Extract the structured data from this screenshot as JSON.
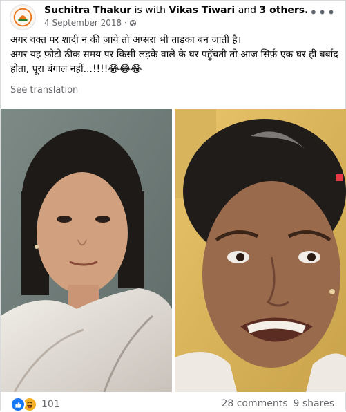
{
  "post": {
    "author": "Suchitra Thakur",
    "with_word": "is with",
    "tagged": "Vikas Tiwari",
    "and_word": "and",
    "others": "3 others.",
    "date": "4 September 2018",
    "privacy_icon": "globe-icon",
    "more_icon": "more-options-icon",
    "text_line1": "अगर वक्त पर शादी न की जाये तो अप्सरा भी ताड़का बन जाती है।",
    "text_line2": "अगर यह फ़ोटो ठीक समय पर किसी लड़के वाले के घर पहुँचती तो आज सिर्फ़ एक घर ही बर्बाद होता, पूरा बंगाल नहीं...!!!!😂😂😂",
    "see_translation": "See translation"
  },
  "footer": {
    "reaction_icons": [
      "like-icon",
      "haha-icon"
    ],
    "reaction_count": "101",
    "comments": "28 comments",
    "shares": "9 shares"
  },
  "colors": {
    "like": "#1877f2",
    "haha": "#f7b125",
    "secondary_text": "#65676b"
  }
}
